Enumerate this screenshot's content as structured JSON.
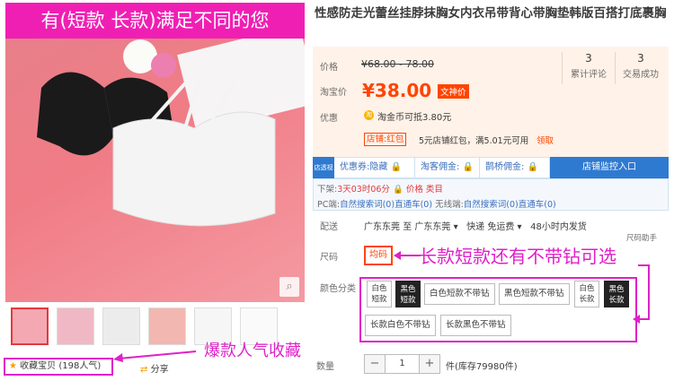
{
  "banner": {
    "text": "有(短款  长款)满足不同的您"
  },
  "title": "性感防走光蕾丝挂脖抹胸女内衣吊带背心带胸垫韩版百搭打底裹胸",
  "price": {
    "label": "价格",
    "original": "¥68.00 - 78.00",
    "taobao_label": "淘宝价",
    "current": "¥38.00",
    "tag": "文神价"
  },
  "stats": {
    "reviews_count": "3",
    "reviews_label": "累计评论",
    "sales_count": "3",
    "sales_label": "交易成功"
  },
  "promo": {
    "label": "优惠",
    "coin_icon_text": "淘",
    "coin_text": "淘金币可抵",
    "coin_amount": "3.80元",
    "shop_badge": "店铺:红包",
    "shop_text": "5元店铺红包，满5.01元可用",
    "claim": "领取"
  },
  "tools": {
    "logo": "店透视",
    "coupon": "优惠券:隐藏",
    "tb_commission": "淘客佣金:",
    "qq_commission": "鹊桥佣金:",
    "monitor_button": "店铺监控入口"
  },
  "listing": {
    "down_label": "下架:",
    "down_time": "3天03时06分",
    "price_class": "价格 类目",
    "pc_label": "PC端:",
    "pc_search": "自然搜索词",
    "pc_search_n": "(0)",
    "pc_train": "直通车",
    "pc_train_n": "(0)",
    "wireless_label": "无线端:",
    "wl_search": "自然搜索词",
    "wl_search_n": "(0)",
    "wl_train": "直通车",
    "wl_train_n": "(0)"
  },
  "shipping": {
    "label": "配送",
    "from": "广东东莞",
    "to_word": "至",
    "to": "广东东莞",
    "method": "快递 免运费",
    "time": "48小时内发货"
  },
  "size": {
    "label": "尺码",
    "helper": "尺码助手",
    "option": "均码"
  },
  "colors": {
    "label": "颜色分类",
    "options": [
      {
        "line1": "白色",
        "line2": "短款"
      },
      {
        "line1": "黑色",
        "line2": "短款"
      },
      {
        "text": "白色短款不带钻"
      },
      {
        "text": "黑色短款不带钻"
      },
      {
        "line1": "白色",
        "line2": "长款"
      },
      {
        "line1": "黑色",
        "line2": "长款"
      },
      {
        "text": "长款白色不带钻"
      },
      {
        "text": "长款黑色不带钻"
      }
    ]
  },
  "quantity": {
    "label": "数量",
    "minus": "−",
    "value": "1",
    "plus": "+",
    "unit": "件(库存79980件)"
  },
  "favorites": {
    "text": "收藏宝贝 (198人气)"
  },
  "share": {
    "text": "分享"
  },
  "annotations": {
    "size_note": "长款短款还有不带钻可选",
    "fav_note": "爆款人气收藏"
  },
  "colors_theme": {
    "accent": "#ff4400",
    "annotation": "#e020c8",
    "banner": "#f01fb4",
    "link": "#3c6fbc"
  }
}
